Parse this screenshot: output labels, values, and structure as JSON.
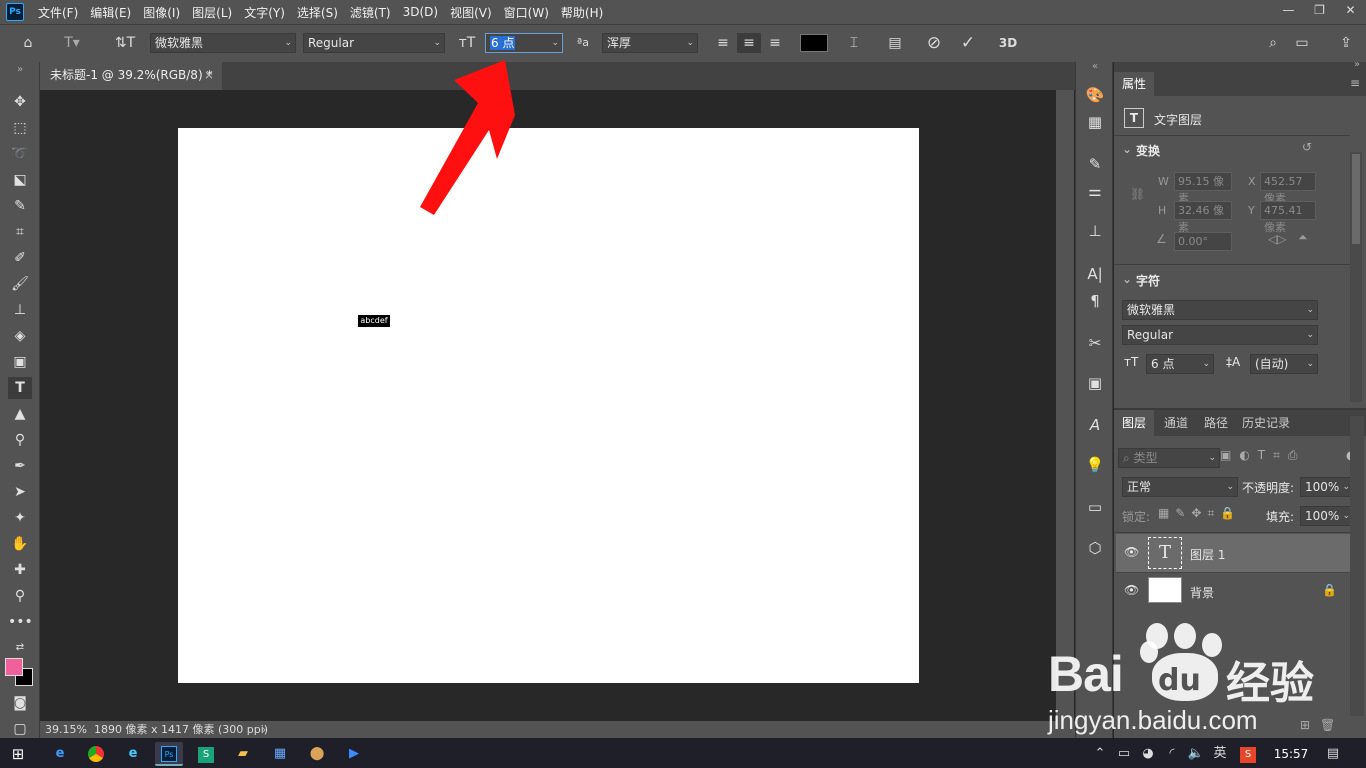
{
  "app": {
    "logo": "Ps"
  },
  "menu": [
    "文件(F)",
    "编辑(E)",
    "图像(I)",
    "图层(L)",
    "文字(Y)",
    "选择(S)",
    "滤镜(T)",
    "3D(D)",
    "视图(V)",
    "窗口(W)",
    "帮助(H)"
  ],
  "window_controls": {
    "minimize": "—",
    "restore": "❐",
    "close": "✕"
  },
  "options": {
    "font_family": "微软雅黑",
    "font_style": "Regular",
    "font_size": "6 点",
    "antialias_label": "ªa",
    "antialias": "浑厚",
    "text_color": "#000000"
  },
  "document": {
    "tab_title": "未标题-1 @ 39.2%(RGB/8) *",
    "selected_text": "abcdef",
    "zoom": "39.15%",
    "size_info": "1890 像素 x 1417 像素 (300 ppi)"
  },
  "properties": {
    "tab": "属性",
    "layer_kind": "文字图层",
    "transform": {
      "title": "变换",
      "w_label": "W",
      "w": "95.15 像素",
      "x_label": "X",
      "x": "452.57 像素",
      "h_label": "H",
      "h": "32.46 像素",
      "y_label": "Y",
      "y": "475.41 像素",
      "angle": "0.00°"
    },
    "character": {
      "title": "字符",
      "font_family": "微软雅黑",
      "font_style": "Regular",
      "font_size": "6 点",
      "leading": "(自动)"
    }
  },
  "layers_panel": {
    "tabs": [
      "图层",
      "通道",
      "路径",
      "历史记录"
    ],
    "filter_placeholder": "类型",
    "blend_mode": "正常",
    "opacity_label": "不透明度:",
    "opacity": "100%",
    "lock_label": "锁定:",
    "fill_label": "填充:",
    "fill": "100%",
    "layers": [
      {
        "name": "图层 1",
        "type": "text",
        "selected": true
      },
      {
        "name": "背景",
        "type": "background",
        "locked": true
      }
    ]
  },
  "watermark": {
    "brand": "Bai",
    "brand2": "du",
    "cn": "经验",
    "url": "jingyan.baidu.com"
  },
  "taskbar": {
    "time": "15:57",
    "ime": "英"
  },
  "colors": {
    "foreground": "#f0609a",
    "background": "#000000",
    "arrow": "#ff1010",
    "accent": "#31a8ff"
  }
}
